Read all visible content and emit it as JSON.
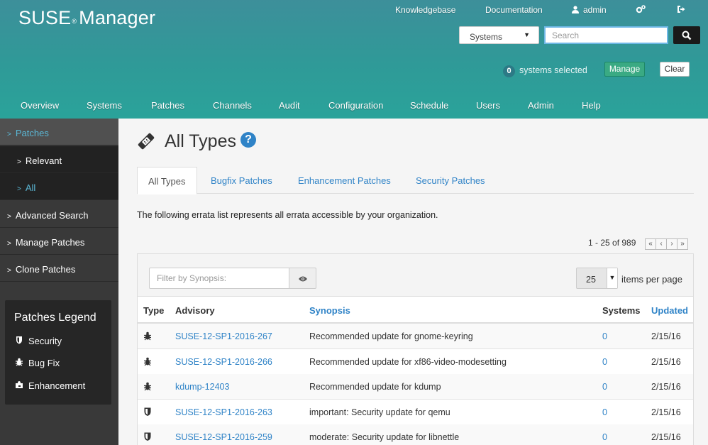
{
  "header": {
    "logo": "SUSE",
    "logo_reg": "®",
    "logo_suffix": "Manager",
    "top_links": {
      "knowledgebase": "Knowledgebase",
      "documentation": "Documentation",
      "user": "admin"
    },
    "search": {
      "scope": "Systems",
      "placeholder": "Search"
    },
    "systems_selected": {
      "count": "0",
      "label": "systems selected"
    },
    "manage_label": "Manage",
    "clear_label": "Clear"
  },
  "nav": [
    "Overview",
    "Systems",
    "Patches",
    "Channels",
    "Audit",
    "Configuration",
    "Schedule",
    "Users",
    "Admin",
    "Help"
  ],
  "sidebar": {
    "top": "Patches",
    "sub": [
      "Relevant",
      "All"
    ],
    "items": [
      "Advanced Search",
      "Manage Patches",
      "Clone Patches"
    ],
    "legend": {
      "title": "Patches Legend",
      "items": [
        "Security",
        "Bug Fix",
        "Enhancement"
      ]
    }
  },
  "page": {
    "title": "All Types",
    "help": "?",
    "tabs": [
      "All Types",
      "Bugfix Patches",
      "Enhancement Patches",
      "Security Patches"
    ],
    "description": "The following errata list represents all errata accessible by your organization.",
    "pagination": "1 - 25 of 989",
    "filter_placeholder": "Filter by Synopsis:",
    "items_per_page_value": "25",
    "items_per_page_label": "items per page"
  },
  "table": {
    "headers": [
      "Type",
      "Advisory",
      "Synopsis",
      "Systems",
      "Updated"
    ],
    "rows": [
      {
        "type": "bug-fix",
        "advisory": "SUSE-12-SP1-2016-267",
        "synopsis": "Recommended update for gnome-keyring",
        "systems": "0",
        "updated": "2/15/16"
      },
      {
        "type": "bug-fix",
        "advisory": "SUSE-12-SP1-2016-266",
        "synopsis": "Recommended update for xf86-video-modesetting",
        "systems": "0",
        "updated": "2/15/16"
      },
      {
        "type": "bug-fix",
        "advisory": "kdump-12403",
        "synopsis": "Recommended update for kdump",
        "systems": "0",
        "updated": "2/15/16"
      },
      {
        "type": "security",
        "advisory": "SUSE-12-SP1-2016-263",
        "synopsis": "important: Security update for qemu",
        "systems": "0",
        "updated": "2/15/16"
      },
      {
        "type": "security",
        "advisory": "SUSE-12-SP1-2016-259",
        "synopsis": "moderate: Security update for libnettle",
        "systems": "0",
        "updated": "2/15/16"
      }
    ]
  }
}
